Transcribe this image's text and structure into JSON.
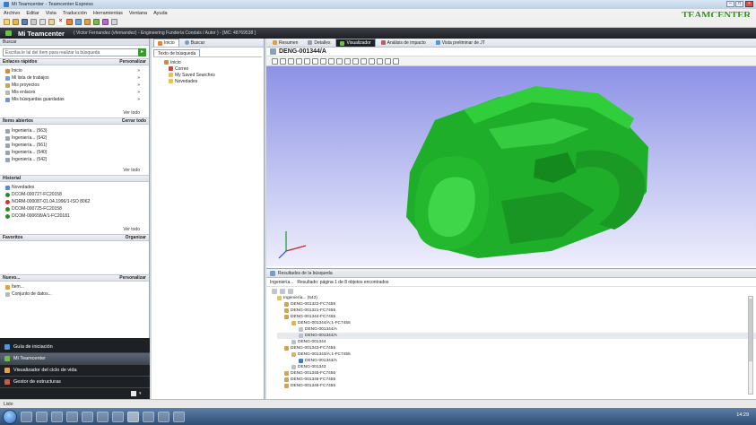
{
  "window": {
    "title": "Mi Teamcenter - Teamcenter Express"
  },
  "brand": "TEAMCENTER",
  "menu": [
    "Archivo",
    "Editar",
    "Vista",
    "Traducción",
    "Herramientas",
    "Ventana",
    "Ayuda"
  ],
  "header": {
    "title": "Mi Teamcenter",
    "user_info": "( Victor Fernandez (vfernandez) - Engineering Fundería Condals / Autor ) - [MC: 48769538 ]"
  },
  "left": {
    "buscar_label": "Buscar",
    "search_placeholder": "Escriba le lal del ítem para realizar la búsqueda",
    "quick_links": {
      "title": "Enlaces rápidos",
      "action": "Personalizar",
      "items": [
        "Inicio",
        "Mi lista de trabajos",
        "Mis proyectos",
        "Mis enlaces",
        "Mis búsquedas guardadas"
      ],
      "more": "Ver todo"
    },
    "open_items": {
      "title": "Ítems abiertos",
      "action": "Cerrar todo",
      "items": [
        "Ingeniería... (563)",
        "Ingeniería... (542)",
        "Ingeniería... (561)",
        "Ingeniería... (540)",
        "Ingeniería... (542)"
      ],
      "more": "Ver todo"
    },
    "history": {
      "title": "Historial",
      "items": [
        "Novedades",
        "DCOM-000727-FC20158",
        "NORM-000087-01.04.1996/1-ISO 8062",
        "DCOM-000725-FC20158",
        "DCOM-000658/A/1-FC20181"
      ],
      "more": "Ver todo"
    },
    "favorites": {
      "title": "Favoritos",
      "action": "Organizar"
    },
    "new": {
      "title": "Nuevo...",
      "action": "Personalizar",
      "items": [
        "Ítem...",
        "Conjunto de datos..."
      ]
    }
  },
  "bottom_nav": [
    "Guía de iniciación",
    "Mi Teamcenter",
    "Visualizador del ciclo de vida",
    "Gestor de estructuras"
  ],
  "middle": {
    "tabs": [
      "Inicio",
      "Buscar"
    ],
    "search_text_tab": "Texto de búsqueda",
    "tree": [
      "Inicio",
      "Correo",
      "My Saved Searches",
      "Novedades"
    ]
  },
  "viewer": {
    "tabs": [
      "Resumen",
      "Detalles",
      "Visualizador",
      "Análisis de impacto",
      "Vista preliminar de JT"
    ],
    "active_tab": "Visualizador",
    "object_id": "DENG-001344/A"
  },
  "results": {
    "title": "Resultados de la búsqueda",
    "subtitle_query": "Ingeniería...",
    "subtitle_info": "Resultado: página 1 de 8 objetos encontrados",
    "rows": [
      {
        "label": "Ingeniería... (542)",
        "indent": 0,
        "type": "folder"
      },
      {
        "label": "DENG-001322-FC7455",
        "indent": 1,
        "type": "item"
      },
      {
        "label": "DENG-001321-FC7455",
        "indent": 1,
        "type": "item"
      },
      {
        "label": "DENG-001344-FC7455",
        "indent": 1,
        "type": "item"
      },
      {
        "label": "DENG-001344/A;1-FC7455",
        "indent": 2,
        "type": "rev"
      },
      {
        "label": "DENG-001344/A",
        "indent": 3,
        "type": "doc"
      },
      {
        "label": "DENG-001344/A",
        "indent": 3,
        "type": "doc"
      },
      {
        "label": "DENG-001344",
        "indent": 2,
        "type": "doc"
      },
      {
        "label": "DENG-001343-FC7455",
        "indent": 1,
        "type": "item"
      },
      {
        "label": "DENG-001343/A;1-FC7455",
        "indent": 2,
        "type": "rev"
      },
      {
        "label": "DENG-001343/A",
        "indent": 3,
        "type": "jt"
      },
      {
        "label": "DENG-001343",
        "indent": 2,
        "type": "doc"
      },
      {
        "label": "DENG-001345-FC7455",
        "indent": 1,
        "type": "item"
      },
      {
        "label": "DENG-001346-FC7455",
        "indent": 1,
        "type": "item"
      },
      {
        "label": "DENG-001348-FC7455",
        "indent": 1,
        "type": "item"
      }
    ],
    "selected_row": 6
  },
  "status": "Listo",
  "clock": "14:29",
  "colors": {
    "header_bg": "#1d2025",
    "brand": "#3e8f2a",
    "model": "#1fae2a",
    "viewport_top": "#8d92e6"
  }
}
